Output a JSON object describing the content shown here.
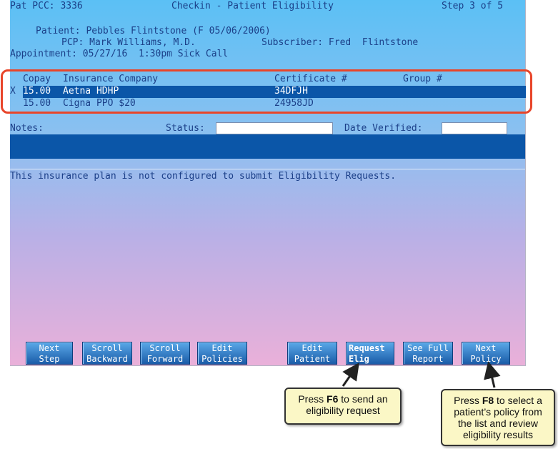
{
  "header": {
    "pat_pcc": "Pat PCC: 3336",
    "title": "Checkin - Patient Eligibility",
    "step": "Step 3 of 5"
  },
  "patient": {
    "patient_line": "Patient: Pebbles Flintstone (F 05/06/2006)",
    "pcp_line": "PCP: Mark Williams, M.D.",
    "subscriber_line": "Subscriber: Fred  Flintstone",
    "appointment_line": "Appointment: 05/27/16  1:30pm Sick Call"
  },
  "policies": {
    "columns": {
      "copay": "Copay",
      "company": "Insurance Company",
      "certificate": "Certificate #",
      "group": "Group #"
    },
    "rows": [
      {
        "marker": "X",
        "copay": "15.00",
        "company": "Aetna HDHP",
        "certificate": "34DFJH",
        "group": ""
      },
      {
        "marker": "",
        "copay": "15.00",
        "company": "Cigna PPO $20",
        "certificate": "24958JD",
        "group": ""
      }
    ]
  },
  "notes": {
    "notes_label": "Notes:",
    "status_label": "Status:",
    "status_value": "",
    "date_label": "Date Verified:",
    "date_value": ""
  },
  "message": "This insurance plan is not configured to submit Eligibility Requests.",
  "fkeys": [
    {
      "line1": "Next",
      "line2": "Step"
    },
    {
      "line1": "Scroll",
      "line2": "Backward"
    },
    {
      "line1": "Scroll",
      "line2": "Forward"
    },
    {
      "line1": "Edit",
      "line2": "Policies"
    },
    {
      "line1": "Edit",
      "line2": "Patient"
    },
    {
      "line1": "Request",
      "line2": "Elig"
    },
    {
      "line1": "See Full",
      "line2": "Report"
    },
    {
      "line1": "Next",
      "line2": "Policy"
    }
  ],
  "callouts": {
    "f6": {
      "pre": "Press ",
      "key": "F6",
      "post": " to send an eligibility request"
    },
    "f8": {
      "pre": "Press ",
      "key": "F8",
      "post": " to select a patient’s policy from the list and review eligibility results"
    }
  },
  "colors": {
    "highlight": "#0b56a8",
    "annotation_border": "#e8452a",
    "callout_bg": "#fbf7c6"
  }
}
